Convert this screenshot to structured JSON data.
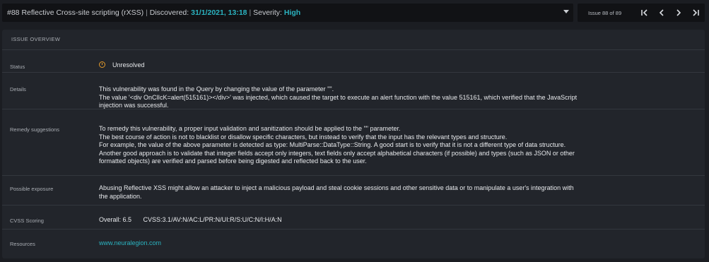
{
  "header": {
    "issue_no": "#88",
    "name": "Reflective Cross-site scripting (rXSS)",
    "discovered_label": "Discovered:",
    "discovered_value": "31/1/2021, 13:18",
    "severity_label": "Severity:",
    "severity_value": "High",
    "separator": "|"
  },
  "pager": {
    "label": "Issue 88 of 89",
    "first_icon": "skip-first-icon",
    "prev_icon": "chevron-left-icon",
    "next_icon": "chevron-right-icon",
    "last_icon": "skip-last-icon"
  },
  "overview": {
    "title": "ISSUE OVERVIEW",
    "status": {
      "label": "Status",
      "value": "Unresolved",
      "icon": "warning-circle-icon",
      "icon_color": "#e39a2b"
    },
    "details": {
      "label": "Details",
      "lines": [
        "This vulnerability was found in the Query by changing the value of the parameter \"\".",
        "The value '<div OnClIcK=alert(515161)></div>' was injected, which caused the target to execute an alert function with the value 515161, which verified that the JavaScript",
        "injection was successful."
      ]
    },
    "remedy": {
      "label": "Remedy suggestions",
      "lines": [
        "To remedy this vulnerability, a proper input validation and sanitization should be applied to the \"\" parameter.",
        "The best course of action is not to blacklist or disallow specific characters, but instead to verify that the input has the relevant types and structure.",
        "For example, the value of the above parameter is detected as type: MultiParse::DataType::String. A good start is to verify that it is not a different type of data structure.",
        "Another good approach is to validate that integer fields accept only integers, text fields only accept alphabetical characters (if possible) and types (such as JSON or other",
        "formatted objects) are verified and parsed before being digested and reflected back to the user."
      ]
    },
    "exposure": {
      "label": "Possible exposure",
      "lines": [
        "Abusing Reflective XSS might allow an attacker to inject a malicious payload and steal cookie sessions and other sensitive data or to manipulate a user's integration with",
        "the application."
      ]
    },
    "cvss": {
      "label": "CVSS Scoring",
      "overall": "Overall: 6.5",
      "vector": "CVSS:3.1/AV:N/AC:L/PR:N/UI:R/S:U/C:N/I:H/A:N"
    },
    "resources": {
      "label": "Resources",
      "link": "www.neuralegion.com"
    }
  },
  "colors": {
    "accent": "#2bb3c0",
    "warning": "#e39a2b",
    "background": "#1b1d22",
    "panel": "#22252b"
  }
}
